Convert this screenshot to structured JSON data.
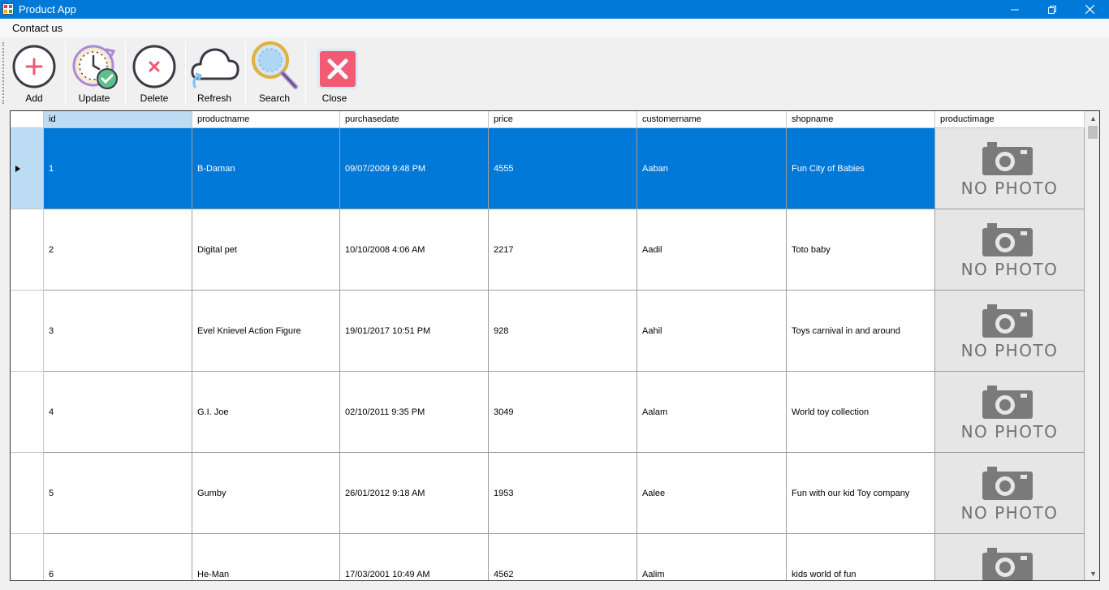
{
  "window": {
    "title": "Product App"
  },
  "menu": {
    "items": [
      "Contact us"
    ]
  },
  "toolbar": {
    "buttons": [
      {
        "label": "Add",
        "icon": "add-icon"
      },
      {
        "label": "Update",
        "icon": "update-icon"
      },
      {
        "label": "Delete",
        "icon": "delete-icon"
      },
      {
        "label": "Refresh",
        "icon": "refresh-icon"
      },
      {
        "label": "Search",
        "icon": "search-icon"
      },
      {
        "label": "Close",
        "icon": "close-icon"
      }
    ]
  },
  "grid": {
    "columns": [
      "id",
      "productname",
      "purchasedate",
      "price",
      "customername",
      "shopname",
      "productimage"
    ],
    "selected_row": 0,
    "rows": [
      {
        "id": "1",
        "productname": "B-Daman",
        "purchasedate": "09/07/2009 9:48 PM",
        "price": "4555",
        "customername": "Aaban",
        "shopname": "Fun City of Babies",
        "productimage": "NO PHOTO"
      },
      {
        "id": "2",
        "productname": "Digital pet",
        "purchasedate": "10/10/2008 4:06 AM",
        "price": "2217",
        "customername": "Aadil",
        "shopname": "Toto baby",
        "productimage": "NO PHOTO"
      },
      {
        "id": "3",
        "productname": "Evel Knievel Action Figure",
        "purchasedate": "19/01/2017 10:51 PM",
        "price": "928",
        "customername": "Aahil",
        "shopname": "Toys carnival in and around",
        "productimage": "NO PHOTO"
      },
      {
        "id": "4",
        "productname": "G.I. Joe",
        "purchasedate": "02/10/2011 9:35 PM",
        "price": "3049",
        "customername": "Aalam",
        "shopname": "World toy collection",
        "productimage": "NO PHOTO"
      },
      {
        "id": "5",
        "productname": "Gumby",
        "purchasedate": "26/01/2012 9:18 AM",
        "price": "1953",
        "customername": "Aalee",
        "shopname": "Fun with our kid Toy company",
        "productimage": "NO PHOTO"
      },
      {
        "id": "6",
        "productname": "He-Man",
        "purchasedate": "17/03/2001 10:49 AM",
        "price": "4562",
        "customername": "Aalim",
        "shopname": "kids world of fun",
        "productimage": "NO PHOTO"
      }
    ]
  },
  "colors": {
    "titlebar": "#0078d7",
    "selection": "#0078d7",
    "header_selected": "#bcdcf4"
  }
}
